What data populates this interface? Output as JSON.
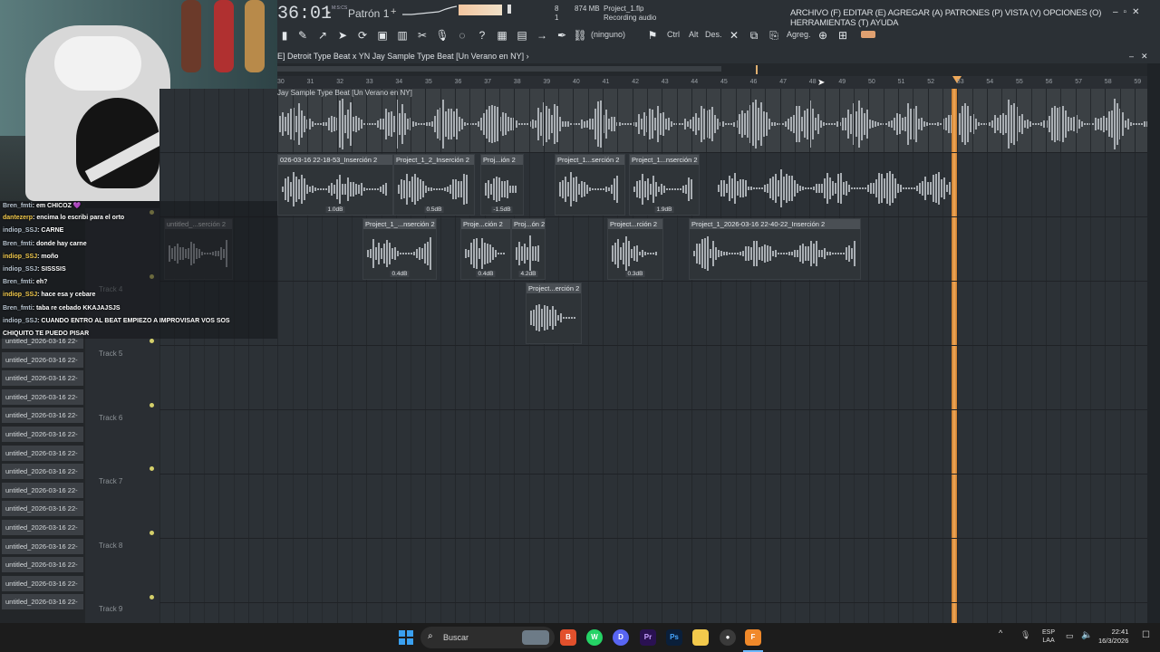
{
  "toolbar": {
    "time": "36:01",
    "time_unit": "M:S:CS",
    "pattern": "Patrón 1",
    "cpu": "8",
    "memory": "874 MB",
    "voices": "1",
    "project_file": "Project_1.flp",
    "status": "Recording audio",
    "snap": "(ninguno)",
    "ctrl": "Ctrl",
    "alt": "Alt",
    "des": "Des.",
    "agreg": "Agreg.",
    "menu": "ARCHIVO (F) EDITAR (E) AGREGAR (A) PATRONES (P) VISTA (V) OPCIONES (O) HERRAMIENTAS (T) AYUDA"
  },
  "playlist": {
    "title": "E] Detroit Type Beat x YN Jay Sample Type Beat [Un Verano en NY] ›",
    "audio_label": "Jay Sample Type Beat [Un Verano en NY]",
    "ruler": [
      "30",
      "31",
      "32",
      "33",
      "34",
      "35",
      "36",
      "37",
      "38",
      "39",
      "40",
      "41",
      "42",
      "43",
      "44",
      "45",
      "46",
      "47",
      "48",
      "49",
      "50",
      "51",
      "52",
      "53",
      "54",
      "55",
      "56",
      "57",
      "58",
      "59"
    ],
    "tracks": [
      "Track 4",
      "Track 5",
      "Track 6",
      "Track 7",
      "Track 8",
      "Track 9"
    ],
    "clips_row1": [
      {
        "name": "026-03-16 22-18-53_Inserción 2",
        "db": "1.0dB"
      },
      {
        "name": "Project_1_2_Inserción 2",
        "db": "0.5dB"
      },
      {
        "name": "Proj...ión 2",
        "db": "-1.5dB"
      },
      {
        "name": "Project_1...serción 2",
        "db": ""
      },
      {
        "name": "Project_1...nserción 2",
        "db": "1.9dB"
      }
    ],
    "clips_row2": [
      {
        "name": "untitled_...serción 2",
        "db": ""
      },
      {
        "name": "Project_1_...nserción 2",
        "db": "0.4dB"
      },
      {
        "name": "Proje...ción 2",
        "db": "0.4dB"
      },
      {
        "name": "Proj...ón 2",
        "db": "4.2dB"
      },
      {
        "name": "Project...rción 2",
        "db": "0.3dB"
      },
      {
        "name": "Project_1_2026-03-16 22-40-22_Inserción 2",
        "db": ""
      }
    ],
    "clips_row3": [
      {
        "name": "Project...erción 2",
        "db": ""
      }
    ]
  },
  "browser": {
    "items": [
      "untitled_2026-03-16 22-",
      "untitled_2026-03-16 22-",
      "untitled_2026-03-16 22-",
      "untitled_2026-03-16 22-",
      "untitled_2026-03-16 22-",
      "untitled_2026-03-16 22-",
      "untitled_2026-03-16 22-",
      "untitled_2026-03-16 22-",
      "untitled_2026-03-16 22-",
      "untitled_2026-03-16 22-",
      "untitled_2026-03-16 22-",
      "untitled_2026-03-16 22-",
      "untitled_2026-03-16 22-",
      "untitled_2026-03-16 22-",
      "untitled_2026-03-16 22-"
    ]
  },
  "chat": [
    {
      "user": "Bren_fmti",
      "text": ": em CHICOZ 💜"
    },
    {
      "user": "dantezerp",
      "text": ": encima lo escribi para el orto"
    },
    {
      "user": "indiop_SSJ",
      "text": ": CARNE"
    },
    {
      "user": "Bren_fmti",
      "text": ": donde hay carne"
    },
    {
      "user": "indiop_SSJ",
      "text": ": moño"
    },
    {
      "user": "indiop_SSJ",
      "text": ": SISSSIS"
    },
    {
      "user": "Bren_fmti",
      "text": ": eh?"
    },
    {
      "user": "indiop_SSJ",
      "text": ": hace esa y cebare"
    },
    {
      "user": "Bren_fmti",
      "text": ": taba re cebado KKAJAJSJS"
    },
    {
      "user": "indiop_SSJ",
      "text": ": CUANDO ENTRO AL BEAT EMPIEZO A IMPROVISAR VOS SOS"
    },
    {
      "user": "",
      "text": "CHIQUITO TE PUEDO PISAR"
    }
  ],
  "taskbar": {
    "search": "Buscar",
    "lang1": "ESP",
    "lang2": "LAA",
    "time": "22:41",
    "date": "16/3/2026"
  },
  "colors": {
    "playhead": "#f0a95a",
    "accent_yellow": "#d4cf6a"
  }
}
